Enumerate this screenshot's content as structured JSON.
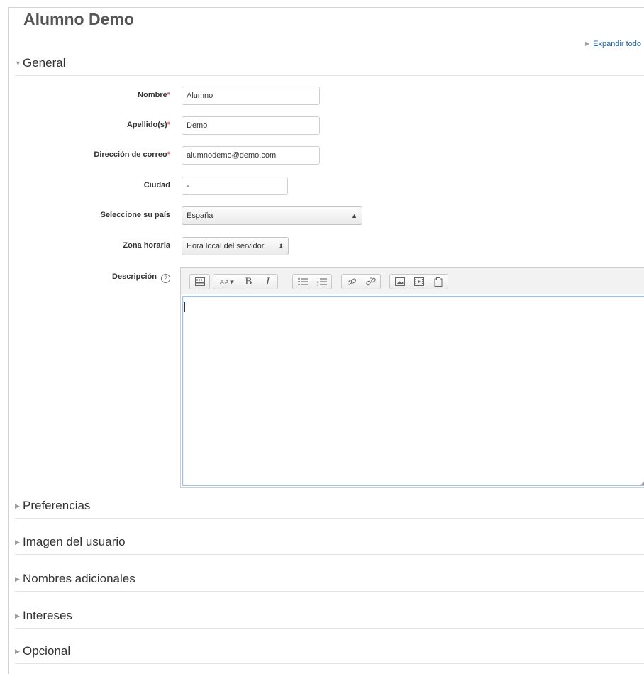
{
  "page": {
    "title": "Alumno Demo",
    "expand_all": "Expandir todo"
  },
  "sections": {
    "general": "General",
    "preferencias": "Preferencias",
    "imagen": "Imagen del usuario",
    "nombres": "Nombres adicionales",
    "intereses": "Intereses",
    "opcional": "Opcional"
  },
  "form": {
    "nombre": {
      "label": "Nombre",
      "value": "Alumno"
    },
    "apellidos": {
      "label": "Apellido(s)",
      "value": "Demo"
    },
    "correo": {
      "label": "Dirección de correo",
      "value": "alumnodemo@demo.com"
    },
    "ciudad": {
      "label": "Ciudad",
      "value": "-"
    },
    "pais": {
      "label": "Seleccione su país",
      "value": "España"
    },
    "zona": {
      "label": "Zona horaria",
      "value": "Hora local del servidor"
    },
    "descripcion": {
      "label": "Descripción",
      "value": ""
    }
  },
  "required_marker": "*",
  "icons": {
    "collapse": "triangle-down",
    "expand": "triangle-right",
    "help": "question-circle",
    "select_arrows": "up-down-arrows"
  },
  "colors": {
    "required": "#d9534f",
    "link": "#1a64a8",
    "focus_border": "#9cc4e8"
  }
}
